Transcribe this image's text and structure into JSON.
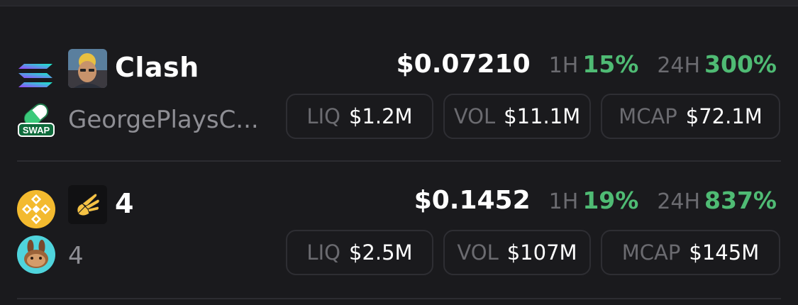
{
  "colors": {
    "background": "#1a1a1d",
    "positive": "#4fbb74",
    "muted_label": "#6b6b70",
    "name_text": "#8e8e94",
    "box_border": "#2e2e33"
  },
  "tokens": [
    {
      "chain_icon": "solana-logo-icon",
      "dex_icon": "pump-pill-swap-icon",
      "dex_badge": "SWAP",
      "avatar_icon": "creator-photo-avatar",
      "symbol": "Clash",
      "name": "GeorgePlaysC...",
      "price": "$0.07210",
      "h1_label": "1H",
      "h1_change": "15%",
      "h24_label": "24H",
      "h24_change": "300%",
      "liq_label": "LIQ",
      "liq_value": "$1.2M",
      "vol_label": "VOL",
      "vol_value": "$11.1M",
      "mcap_label": "MCAP",
      "mcap_value": "$72.1M"
    },
    {
      "chain_icon": "bnb-logo-icon",
      "dex_icon": "pancakeswap-bunny-icon",
      "avatar_icon": "hand-sign-avatar",
      "symbol": "4",
      "name": "4",
      "price": "$0.1452",
      "h1_label": "1H",
      "h1_change": "19%",
      "h24_label": "24H",
      "h24_change": "837%",
      "liq_label": "LIQ",
      "liq_value": "$2.5M",
      "vol_label": "VOL",
      "vol_value": "$107M",
      "mcap_label": "MCAP",
      "mcap_value": "$145M"
    }
  ]
}
